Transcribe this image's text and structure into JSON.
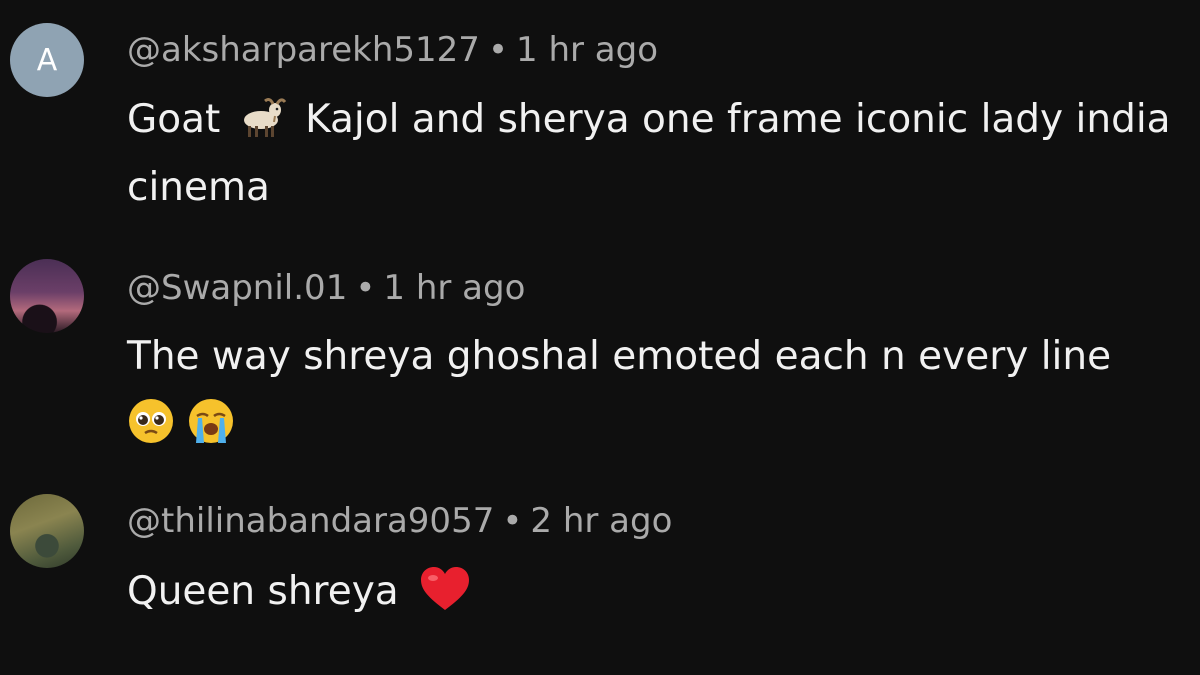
{
  "comments": [
    {
      "avatar_letter": "A",
      "username": "@aksharparekh5127",
      "separator": "•",
      "time": "1 hr ago",
      "text_before_emoji": "Goat",
      "emoji": "goat-emoji",
      "text_after_emoji": "Kajol and sherya one frame iconic lady india cinema"
    },
    {
      "avatar": "sunset-photo-avatar",
      "username": "@Swapnil.01",
      "separator": "•",
      "time": "1 hr ago",
      "text": "The way shreya ghoshal emoted each n every line",
      "emojis": [
        "pleading-face-emoji",
        "loudly-crying-face-emoji"
      ]
    },
    {
      "avatar": "person-photo-avatar",
      "username": "@thilinabandara9057",
      "separator": "•",
      "time": "2 hr ago",
      "text": "Queen shreya",
      "emoji": "red-heart-emoji"
    }
  ],
  "colors": {
    "background": "#0f0f0f",
    "meta_text": "#aaaaaa",
    "body_text": "#f1f1f1",
    "letter_avatar": "#8fa3b3"
  }
}
